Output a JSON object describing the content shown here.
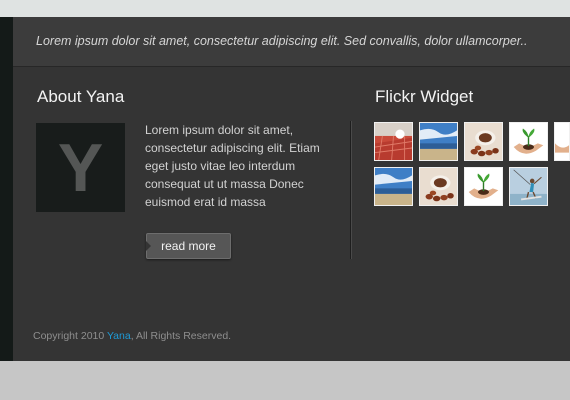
{
  "tagline": "Lorem ipsum dolor sit amet, consectetur adipiscing elit. Sed convallis, dolor ullamcorper..",
  "about": {
    "title": "About Yana",
    "avatar_letter": "Y",
    "text": "Lorem ipsum dolor sit amet, consectetur adipiscing elit. Etiam eget justo vitae leo interdum consequat ut ut massa Donec euismod erat id massa",
    "read_more": "read more"
  },
  "flickr": {
    "title": "Flickr Widget",
    "photos": [
      {
        "subject": "table-tennis"
      },
      {
        "subject": "beach"
      },
      {
        "subject": "coffee-beans"
      },
      {
        "subject": "sprout-in-hands"
      },
      {
        "subject": "hand-cropped"
      },
      {
        "subject": "beach"
      },
      {
        "subject": "coffee-beans"
      },
      {
        "subject": "sprout-in-hands"
      },
      {
        "subject": "kitesurfer"
      }
    ]
  },
  "footer": {
    "prefix": "Copyright 2010 ",
    "brand": "Yana",
    "suffix": ", All Rights Reserved."
  },
  "colors": {
    "accent": "#1e9ad6",
    "panel": "#343434",
    "page": "#c6c6c6"
  }
}
